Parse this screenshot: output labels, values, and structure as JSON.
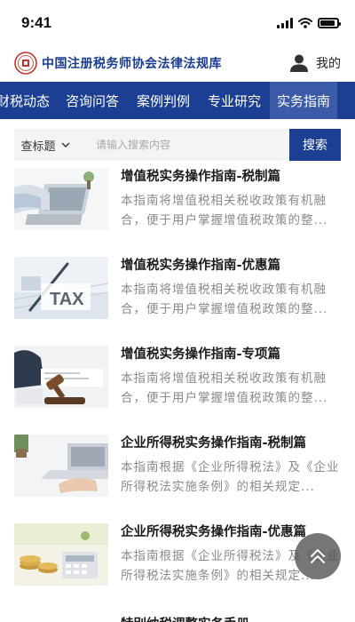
{
  "status": {
    "time": "9:41"
  },
  "header": {
    "title": "中国注册税务师协会法律法规库",
    "mine_label": "我的",
    "brand_color": "#1a3c93"
  },
  "nav": {
    "tabs": [
      {
        "label": "财税动态"
      },
      {
        "label": "咨询问答"
      },
      {
        "label": "案例判例"
      },
      {
        "label": "专业研究"
      },
      {
        "label": "实务指南",
        "active": true
      }
    ],
    "bar_color": "#1c3f94",
    "active_color": "#3b5aa7"
  },
  "search": {
    "filter_label": "查标题",
    "placeholder": "请输入搜索内容",
    "button_label": "搜索"
  },
  "articles": [
    {
      "title": "增值税实务操作指南-税制篇",
      "desc": "本指南将增值税相关税收政策有机融合，便于用户掌握增值税政策的整...",
      "thumb": "laptop-desk-photo"
    },
    {
      "title": "增值税实务操作指南-优惠篇",
      "desc": "本指南将增值税相关税收政策有机融合，便于用户掌握增值税政策的整...",
      "thumb": "tax-documents-photo"
    },
    {
      "title": "增值税实务操作指南-专项篇",
      "desc": "本指南将增值税相关税收政策有机融合，便于用户掌握增值税政策的整...",
      "thumb": "gavel-law-photo"
    },
    {
      "title": "企业所得税实务操作指南-税制篇",
      "desc": "本指南根据《企业所得税法》及《企业所得税法实施条例》的相关规定...",
      "thumb": "hands-laptop-photo"
    },
    {
      "title": "企业所得税实务操作指南-优惠篇",
      "desc": "本指南根据《企业所得税法》及《企业所得税法实施条例》的相关规定...",
      "thumb": "coins-calculator-photo"
    }
  ],
  "partial_next_title": "特别纳税调整实务手册",
  "icons": {
    "user": "user-icon",
    "chevron": "chevron-down-icon",
    "back_to_top": "double-chevron-up-icon",
    "logo": "association-seal-logo"
  }
}
